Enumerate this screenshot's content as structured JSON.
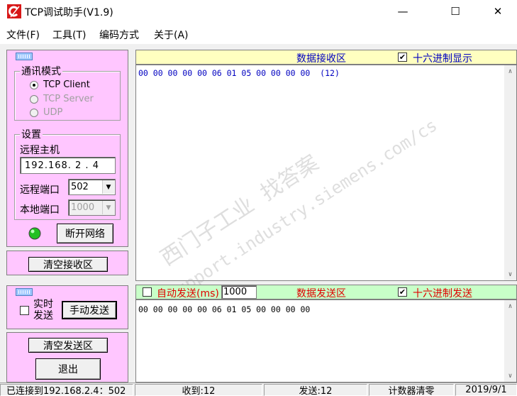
{
  "window": {
    "title": "TCP调试助手(V1.9)",
    "icon": "tcp-c-logo-icon",
    "minimize_glyph": "—",
    "maximize_glyph": "☐",
    "close_glyph": "✕"
  },
  "menu": [
    "文件(F)",
    "工具(T)",
    "编码方式",
    "关于(A)"
  ],
  "comm_mode": {
    "title": "通讯模式",
    "options": [
      {
        "label": "TCP Client",
        "selected": true,
        "enabled": true
      },
      {
        "label": "TCP Server",
        "selected": false,
        "enabled": false
      },
      {
        "label": "UDP",
        "selected": false,
        "enabled": false
      }
    ]
  },
  "settings": {
    "title": "设置",
    "remote_host_label": "远程主机",
    "remote_host_value": "192.168. 2 . 4",
    "remote_port_label": "远程端口",
    "remote_port_value": "502",
    "local_port_label": "本地端口",
    "local_port_value": "1000"
  },
  "connection": {
    "led_color": "#22c022",
    "disconnect_label": "断开网络"
  },
  "clear_receive_label": "清空接收区",
  "send_panel": {
    "realtime_label_line1": "实时",
    "realtime_label_line2": "发送",
    "manual_send_label": "手动发送",
    "clear_send_label": "清空发送区",
    "exit_label": "退出"
  },
  "receive": {
    "header_title": "数据接收区",
    "hex_display_label": "十六进制显示",
    "hex_display_checked": true,
    "content": "00 00 00 00 00 06 01 05 00 00 00 00  (12)"
  },
  "send": {
    "auto_send_label": "自动发送(ms)",
    "auto_send_checked": false,
    "interval_value": "1000",
    "header_title": "数据发送区",
    "hex_send_label": "十六进制发送",
    "hex_send_checked": true,
    "content": "00 00 00 00 00 06 01 05 00 00 00 00"
  },
  "watermark": {
    "line1": "西门子工业  找答案",
    "line2": "support.industry.siemens.com/cs"
  },
  "status": {
    "connected": "已连接到192.168.2.4：502",
    "received": "收到:12",
    "sent": "发送:12",
    "reset_counter": "计数器清零",
    "date": "2019/9/1"
  },
  "colors": {
    "panel_pink": "#ffc6ff",
    "recv_header_bg": "#ffffc0",
    "send_header_bg": "#c8ffc8",
    "recv_text_color": "#0000c0",
    "send_header_text_color": "#e00000"
  }
}
